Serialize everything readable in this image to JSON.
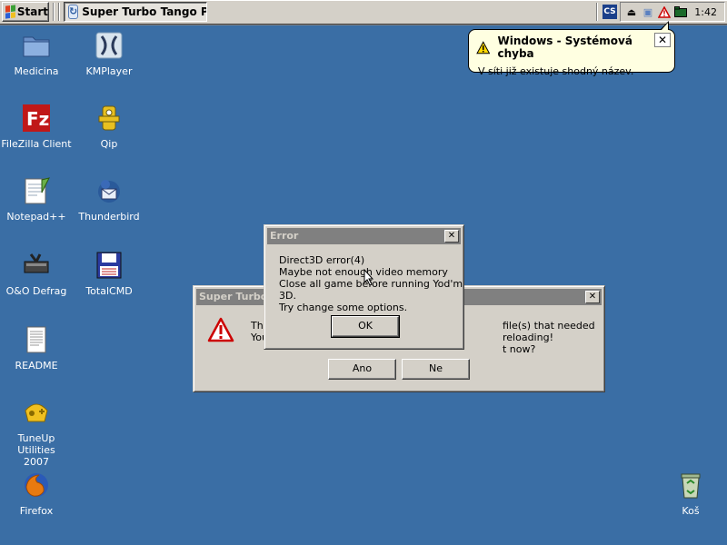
{
  "taskbar": {
    "start_label": "Start",
    "active_task_label": "Super Turbo Tango P...",
    "tray": {
      "cs_badge": "CS",
      "clock": "1:42"
    }
  },
  "balloon": {
    "title": "Windows - Systémová chyba",
    "message": "V síti již existuje shodný název.",
    "close_glyph": "✕"
  },
  "desktop_icons": [
    {
      "label": "Medicina",
      "icon": "folder-icon"
    },
    {
      "label": "KMPlayer",
      "icon": "kmplayer-icon"
    },
    {
      "label": "FileZilla Client",
      "icon": "filezilla-icon"
    },
    {
      "label": "Qip",
      "icon": "qip-icon"
    },
    {
      "label": "Notepad++",
      "icon": "notepad-icon"
    },
    {
      "label": "Thunderbird",
      "icon": "thunderbird-icon"
    },
    {
      "label": "O&O Defrag",
      "icon": "defrag-icon"
    },
    {
      "label": "TotalCMD",
      "icon": "totalcmd-icon"
    },
    {
      "label": "README",
      "icon": "document-icon"
    },
    {
      "label": "TuneUp Utilities\n2007",
      "label_line1": "TuneUp Utilities",
      "label_line2": "2007",
      "icon": "tuneup-icon"
    },
    {
      "label": "Firefox",
      "icon": "firefox-icon"
    },
    {
      "label": "Koš",
      "icon": "recycle-bin-icon"
    }
  ],
  "super_turbo_dialog": {
    "title": "Super Turbo",
    "message_line1_left": "The",
    "message_line1_right": "file(s) that needed reloading!",
    "message_line2_left": "You",
    "message_line2_right": "t now?",
    "yes_label": "Ano",
    "no_label": "Ne"
  },
  "error_dialog": {
    "title": "Error",
    "lines": [
      "Direct3D error(4)",
      "Maybe not enough video memory",
      "Close all game before running Yod'm 3D.",
      "Try change some options."
    ],
    "ok_label": "OK"
  },
  "colors": {
    "desktop": "#3a6ea5",
    "inactive_titlebar": "#808080",
    "face": "#d4d0c8",
    "balloon_bg": "#ffffe1"
  }
}
